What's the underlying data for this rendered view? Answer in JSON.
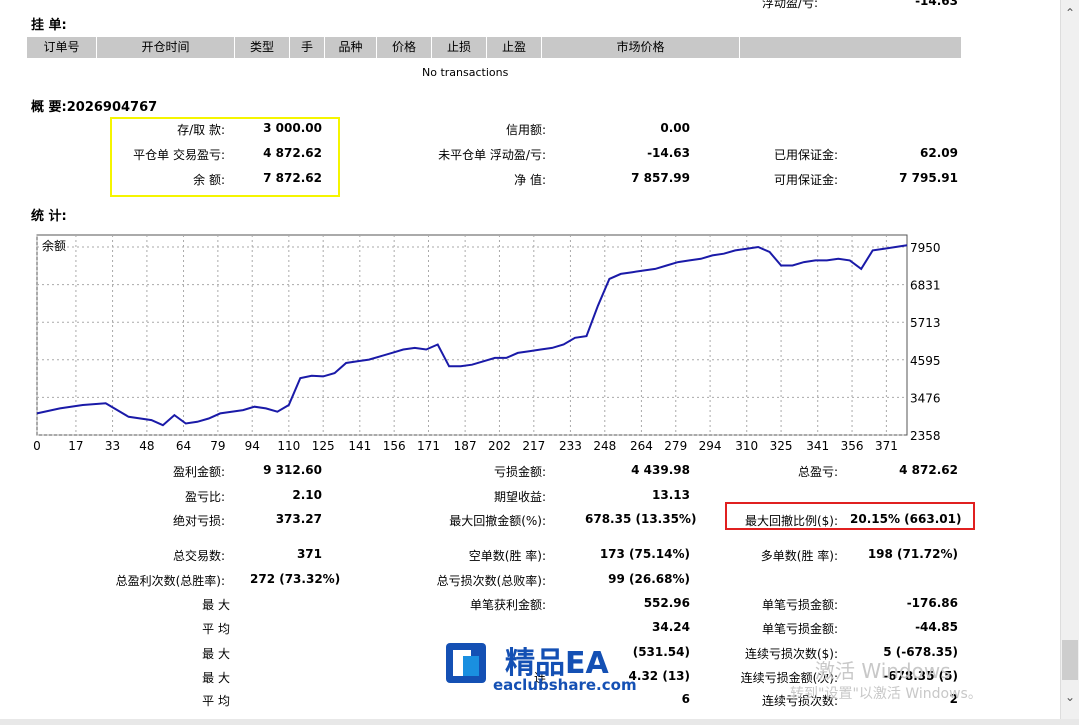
{
  "top_partial": {
    "label": "浮动盈/亏:",
    "value": "-14.63"
  },
  "pending": {
    "title": "挂 单:",
    "columns": [
      "订单号",
      "开仓时间",
      "类型",
      "手",
      "品种",
      "价格",
      "止损",
      "止盈",
      "市场价格",
      ""
    ],
    "empty": "No transactions"
  },
  "summary": {
    "title": "概 要:2026904767",
    "col1": [
      {
        "label": "存/取 款:",
        "value": "3 000.00"
      },
      {
        "label": "平仓单 交易盈亏:",
        "value": "4 872.62"
      },
      {
        "label": "余 额:",
        "value": "7 872.62"
      }
    ],
    "col2": [
      {
        "label": "信用额:",
        "value": "0.00"
      },
      {
        "label": "未平仓单 浮动盈/亏:",
        "value": "-14.63"
      },
      {
        "label": "净 值:",
        "value": "7 857.99"
      }
    ],
    "col3": [
      {
        "label": "已用保证金:",
        "value": "62.09"
      },
      {
        "label": "可用保证金:",
        "value": "7 795.91"
      }
    ]
  },
  "stats_title": "统 计:",
  "chart_data": {
    "type": "line",
    "title": "余额",
    "x_ticks": [
      "0",
      "17",
      "33",
      "48",
      "64",
      "79",
      "94",
      "110",
      "125",
      "141",
      "156",
      "171",
      "187",
      "202",
      "217",
      "233",
      "248",
      "264",
      "279",
      "294",
      "310",
      "325",
      "341",
      "356",
      "371"
    ],
    "y_ticks": [
      "7950",
      "6831",
      "5713",
      "4595",
      "3476",
      "2358"
    ],
    "ylim": [
      2358,
      7950
    ],
    "xlim": [
      0,
      380
    ],
    "grid": true,
    "series": [
      {
        "color": "#1a1aa8",
        "x": [
          0,
          10,
          20,
          30,
          40,
          50,
          55,
          60,
          65,
          70,
          75,
          80,
          85,
          90,
          95,
          100,
          105,
          110,
          115,
          120,
          125,
          130,
          135,
          140,
          145,
          150,
          155,
          160,
          165,
          170,
          175,
          180,
          185,
          190,
          195,
          200,
          205,
          210,
          215,
          220,
          225,
          230,
          235,
          240,
          245,
          250,
          255,
          260,
          265,
          270,
          275,
          280,
          285,
          290,
          295,
          300,
          305,
          310,
          315,
          320,
          325,
          330,
          335,
          340,
          345,
          350,
          355,
          360,
          365,
          370,
          375,
          380
        ],
        "y": [
          3000,
          3150,
          3250,
          3300,
          2900,
          2800,
          2650,
          2950,
          2700,
          2750,
          2850,
          3000,
          3050,
          3100,
          3200,
          3150,
          3050,
          3250,
          4050,
          4120,
          4100,
          4200,
          4500,
          4550,
          4600,
          4700,
          4800,
          4900,
          4950,
          4900,
          5050,
          4400,
          4400,
          4450,
          4550,
          4650,
          4650,
          4800,
          4850,
          4900,
          4950,
          5050,
          5250,
          5300,
          6200,
          7000,
          7150,
          7200,
          7250,
          7300,
          7400,
          7500,
          7550,
          7600,
          7700,
          7750,
          7850,
          7900,
          7950,
          7800,
          7400,
          7400,
          7500,
          7550,
          7550,
          7600,
          7550,
          7300,
          7850,
          7900,
          7950,
          8000
        ]
      }
    ]
  },
  "stats": {
    "row1": [
      {
        "label": "盈利金额:",
        "value": "9 312.60"
      },
      {
        "label": "亏损金额:",
        "value": "4 439.98"
      },
      {
        "label": "总盈亏:",
        "value": "4 872.62"
      }
    ],
    "row2": [
      {
        "label": "盈亏比:",
        "value": "2.10"
      },
      {
        "label": "期望收益:",
        "value": "13.13"
      }
    ],
    "row3": [
      {
        "label": "绝对亏损:",
        "value": "373.27"
      },
      {
        "label": "最大回撤金额(%):",
        "value": "678.35 (13.35%)"
      },
      {
        "label": "最大回撤比例($):",
        "value": "20.15% (663.01)"
      }
    ],
    "row4": [
      {
        "label": "总交易数:",
        "value": "371"
      },
      {
        "label": "空单数(胜 率):",
        "value": "173 (75.14%)"
      },
      {
        "label": "多单数(胜 率):",
        "value": "198 (71.72%)"
      }
    ],
    "row5": [
      {
        "label": "总盈利次数(总胜率):",
        "value": "272 (73.32%)"
      },
      {
        "label": "总亏损次数(总败率):",
        "value": "99 (26.68%)"
      }
    ],
    "row6": [
      {
        "label": "最 大",
        "value": ""
      },
      {
        "label": "单笔获利金额:",
        "value": "552.96"
      },
      {
        "label": "单笔亏损金额:",
        "value": "-176.86"
      }
    ],
    "row7": [
      {
        "label": "平 均",
        "value": ""
      },
      {
        "label": "",
        "value": "34.24"
      },
      {
        "label": "单笔亏损金额:",
        "value": "-44.85"
      }
    ],
    "row8": [
      {
        "label": "最 大",
        "value": ""
      },
      {
        "label": "",
        "value": "(531.54)"
      },
      {
        "label": "连续亏损次数($):",
        "value": "5 (-678.35)"
      }
    ],
    "row9": [
      {
        "label": "最 大",
        "value": ""
      },
      {
        "label": "连",
        "value": "4.32 (13)"
      },
      {
        "label": "连续亏损金额(次):",
        "value": "-678.35 (5)"
      }
    ],
    "row10": [
      {
        "label": "平 均",
        "value": ""
      },
      {
        "label": "",
        "value": "6"
      },
      {
        "label": "连续亏损次数:",
        "value": "2"
      }
    ]
  },
  "watermark": {
    "brand": "精品EA",
    "url": "eaclubshare.com"
  },
  "windows": {
    "line1": "激活 Windows",
    "line2": "转到\"设置\"以激活 Windows。"
  }
}
